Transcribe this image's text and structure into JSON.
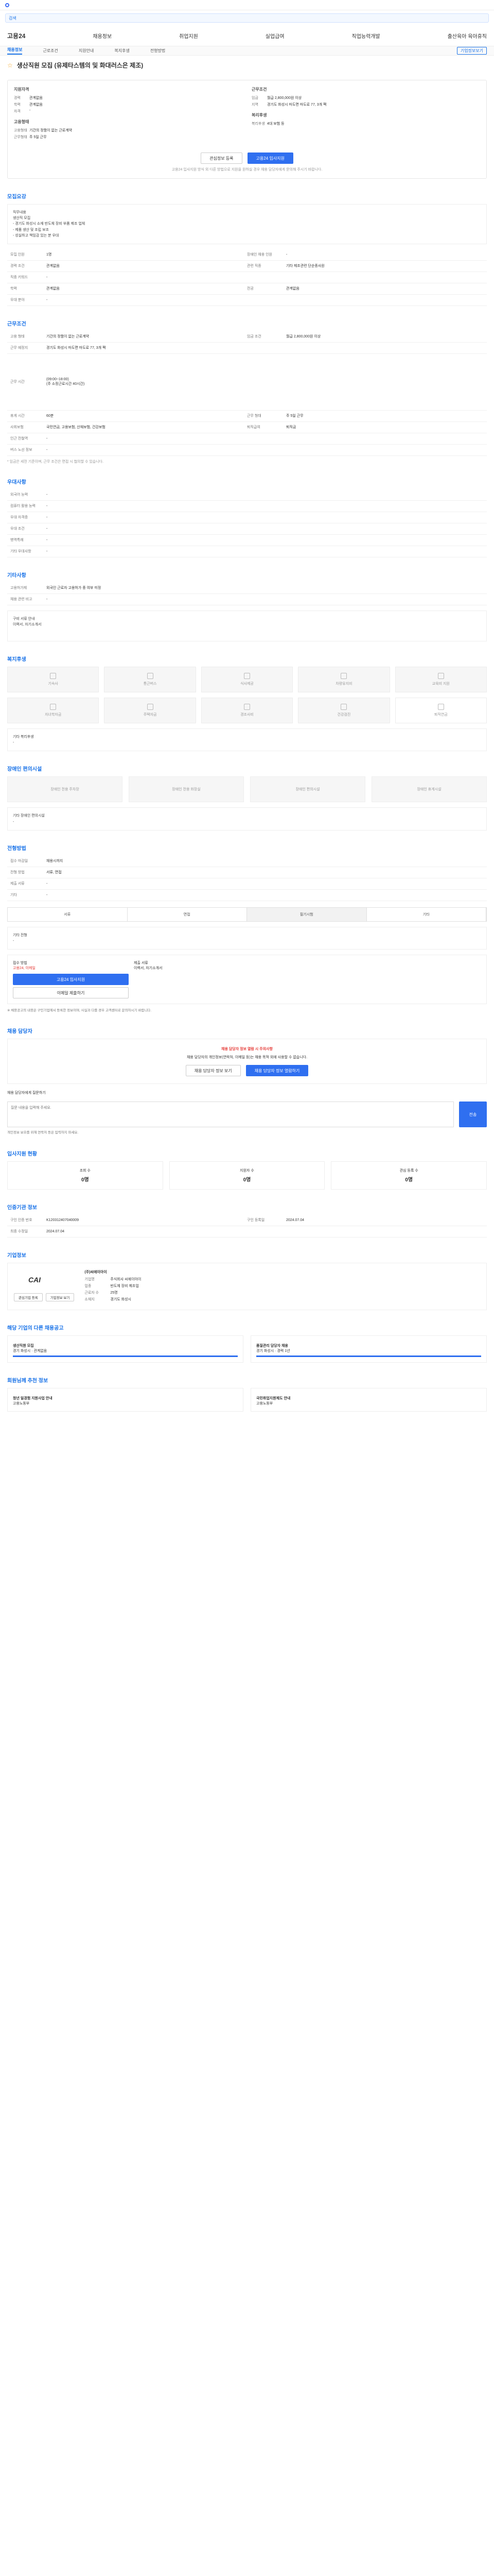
{
  "search": {
    "value": "검색"
  },
  "nav": {
    "brand": "고용24",
    "items": [
      "채용정보",
      "취업지원",
      "실업급여",
      "직업능력개발",
      "출산육아 육아휴직"
    ]
  },
  "subnav": {
    "items": [
      "채용정보",
      "근로조건",
      "지원안내",
      "복지후생",
      "전형방법"
    ],
    "right": "기업정보보기"
  },
  "title": "생산직원 모집 (유제타스템의 및 화대러스은 제조)",
  "summary": {
    "left_title": "지원자격",
    "left_rows": [
      [
        "경력",
        "관계없음"
      ],
      [
        "학력",
        "관계없음"
      ],
      [
        "자격",
        "-"
      ]
    ],
    "left_title2": "고용형태",
    "left_rows2": [
      [
        "고용형태",
        "기간의 정함이 없는 근로계약"
      ],
      [
        "근무형태",
        "주 5일 근무"
      ]
    ],
    "right_title": "근무조건",
    "right_rows": [
      [
        "임금",
        "월급 2,800,000원 이상"
      ],
      [
        "지역",
        "경기도 화성시 마도면 마도로 77, 3개 팩"
      ]
    ],
    "right_title2": "복리후생",
    "right_rows2": [
      [
        "복리후생",
        "4대 보험 등"
      ]
    ]
  },
  "buttons": {
    "save": "관심정보 등록",
    "apply": "고용24 입사지원"
  },
  "summary_note": "고용24 입사지원 방식 외 다른 방법으로 지원을 원하실 경우 채용 담당자에게 문의해 주시기 바랍니다.",
  "sections": {
    "recruit": "모집요강",
    "work": "근무조건",
    "qual": "우대사항",
    "other": "기타사항",
    "welfare": "복지후생",
    "barrier": "장애인 편의시설",
    "process": "전형방법",
    "inquire": "채용 담당자",
    "stats": "입사지원 현황",
    "official": "인증기관 정보",
    "company": "기업정보",
    "similar": "해당 기업의 다른 채용공고",
    "recommend": "회원님께 추천 정보"
  },
  "recruit": {
    "desc": "직무내용\n생산직 모집\n- 경기도 화성시 소재 반도체 장비 부품 제조 업체\n- 제품 생산 및 조립 보조\n- 성실하고 책임감 있는 분 우대",
    "rows": [
      [
        "모집 인원",
        "1명",
        "장애인 채용 인원",
        "-"
      ],
      [
        "경력 조건",
        "관계없음",
        "관련 직종",
        "기타 제조관련 단순종사원"
      ],
      [
        "직종 키워드",
        "-",
        "",
        ""
      ],
      [
        "학력",
        "관계없음",
        "전공",
        "관계없음"
      ],
      [
        "우대 분야",
        "-",
        "",
        ""
      ]
    ]
  },
  "work": {
    "rows": [
      [
        "고용 형태",
        "기간의 정함이 없는 근로계약",
        "임금 조건",
        "월급 2,800,000원 이상"
      ],
      [
        "근무 예정지",
        "경기도 화성시 마도면 마도로 77, 3개 팩",
        "",
        ""
      ],
      [
        "근무 시간",
        "(09:00~18:00)\n(주 소정근로시간 40시간)",
        "",
        ""
      ],
      [
        "휴게 시간",
        "60분",
        "근무 형태",
        "주 5일 근무"
      ],
      [
        "사회보험",
        "국민연금, 고용보험, 산재보험, 건강보험",
        "퇴직급여",
        "퇴직금"
      ],
      [
        "인근 전철역",
        "-",
        "",
        ""
      ],
      [
        "버스 노선 정보",
        "-",
        "",
        ""
      ]
    ],
    "note": "* 임금은 세전 기준이며, 근무 조건은 면접 시 협의할 수 있습니다."
  },
  "qual": {
    "rows": [
      [
        "외국어 능력",
        "-"
      ],
      [
        "컴퓨터 활용 능력",
        "-"
      ],
      [
        "우대 자격증",
        "-"
      ],
      [
        "우대 조건",
        "-"
      ],
      [
        "병역특례",
        "-"
      ],
      [
        "기타 우대사항",
        "-"
      ]
    ]
  },
  "other": {
    "rows": [
      [
        "고용허가제",
        "외국인 근로자 고용허가 중 여부 미정"
      ],
      [
        "채용 관련 비고",
        "-"
      ]
    ],
    "box": "구비 서류 안내\n이력서, 자기소개서"
  },
  "welfare": {
    "items": [
      "기숙사",
      "통근버스",
      "식사제공",
      "차량유지비",
      "교육비 지원",
      "자녀학자금",
      "주택자금",
      "경조사비",
      "건강검진",
      "퇴직연금"
    ],
    "extra_title": "기타 복리후생",
    "extra_value": "-"
  },
  "barrier": {
    "items": [
      "장애인 전용 주차장",
      "장애인 전용 화장실",
      "장애인 편의시설",
      "장애인 휴게시설"
    ],
    "extra_title": "기타 장애인 편의시설",
    "extra_value": "-"
  },
  "process": {
    "rows": [
      [
        "접수 마감일",
        "채용시까지",
        "",
        ""
      ],
      [
        "전형 방법",
        "서류, 면접",
        "",
        ""
      ],
      [
        "제출 서류",
        "-",
        "",
        ""
      ],
      [
        "기타",
        "-",
        "",
        ""
      ]
    ],
    "tabs": [
      "서류",
      "면접",
      "필기시험",
      "기타"
    ],
    "extra_title": "기타 전형",
    "extra_value": "-",
    "apply_title": "접수 방법",
    "apply_value": "고용24, 이메일",
    "apply_btn": "고용24 입사지원",
    "email_btn": "이메일 제출하기",
    "doc_title": "제출 서류",
    "doc_value": "이력서, 자기소개서",
    "notice": "※ 채용공고의 내용은 구인기업에서 등록한 정보이며, 사실과 다를 경우 고객센터로 문의하시기 바랍니다."
  },
  "inquire": {
    "title": "채용 담당자 정보 열람 시 주의사항",
    "body": "채용 담당자의 개인정보(연락처, 이메일 등)는 채용 목적 외에 사용할 수 없습니다.",
    "btn1": "채용 담당자 정보 보기",
    "btn2": "채용 담당자 정보 열람하기",
    "q_label": "채용 담당자에게 질문하기",
    "placeholder": "질문 내용을 입력해 주세요.",
    "send": "전송",
    "warn": "개인정보 보호를 위해 연락처 등은 입력하지 마세요."
  },
  "stats": {
    "items": [
      [
        "조회 수",
        "0명"
      ],
      [
        "지원자 수",
        "0명"
      ],
      [
        "관심 등록 수",
        "0명"
      ]
    ]
  },
  "official": {
    "rows": [
      [
        "구인 인증 번호",
        "K120312407040009",
        "구인 등록일",
        "2024.07.04"
      ],
      [
        "최종 수정일",
        "2024.07.04",
        "",
        ""
      ]
    ]
  },
  "company": {
    "logo": "CAI",
    "name": "(주)씨에이아이",
    "rows": [
      [
        "기업명",
        "주식회사 씨에이아이"
      ],
      [
        "업종",
        "반도체 장비 제조업"
      ],
      [
        "근로자 수",
        "25명"
      ],
      [
        "소재지",
        "경기도 화성시"
      ]
    ],
    "btn_follow": "관심기업 등록",
    "btn_info": "기업정보 보기"
  },
  "similar": {
    "cards": [
      {
        "title": "생산직원 모집",
        "meta": "경기 화성시 · 관계없음"
      },
      {
        "title": "품질관리 담당자 채용",
        "meta": "경기 화성시 · 경력 1년"
      }
    ]
  },
  "recommend": {
    "cards": [
      {
        "title": "청년 일경험 지원사업 안내",
        "meta": "고용노동부"
      },
      {
        "title": "국민취업지원제도 안내",
        "meta": "고용노동부"
      }
    ]
  }
}
